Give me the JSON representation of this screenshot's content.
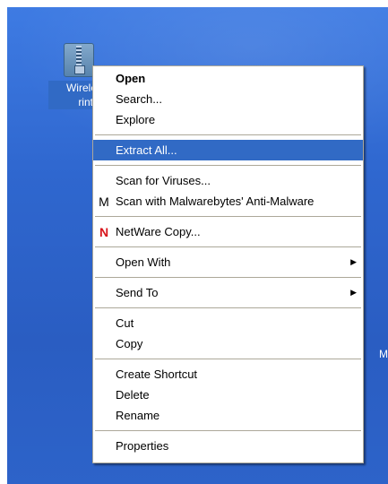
{
  "desktop": {
    "icon": {
      "name": "zip-folder-icon",
      "label_lines": [
        "Wireless",
        "rinting"
      ]
    },
    "edge_text": "M"
  },
  "context_menu": {
    "groups": [
      [
        {
          "label": "Open",
          "bold": true
        },
        {
          "label": "Search..."
        },
        {
          "label": "Explore"
        }
      ],
      [
        {
          "label": "Extract All...",
          "selected": true
        }
      ],
      [
        {
          "label": "Scan for Viruses..."
        },
        {
          "label": "Scan with Malwarebytes' Anti-Malware",
          "icon": "malwarebytes-icon"
        }
      ],
      [
        {
          "label": "NetWare Copy...",
          "icon": "netware-icon"
        }
      ],
      [
        {
          "label": "Open With",
          "submenu": true
        }
      ],
      [
        {
          "label": "Send To",
          "submenu": true
        }
      ],
      [
        {
          "label": "Cut"
        },
        {
          "label": "Copy"
        }
      ],
      [
        {
          "label": "Create Shortcut"
        },
        {
          "label": "Delete"
        },
        {
          "label": "Rename"
        }
      ],
      [
        {
          "label": "Properties"
        }
      ]
    ],
    "submenu_arrow": "▶",
    "icons": {
      "malwarebytes": "M",
      "netware": "N"
    }
  },
  "colors": {
    "selection": "#316ac5",
    "menu_border": "#aca899",
    "desktop": "#2f67cf"
  }
}
